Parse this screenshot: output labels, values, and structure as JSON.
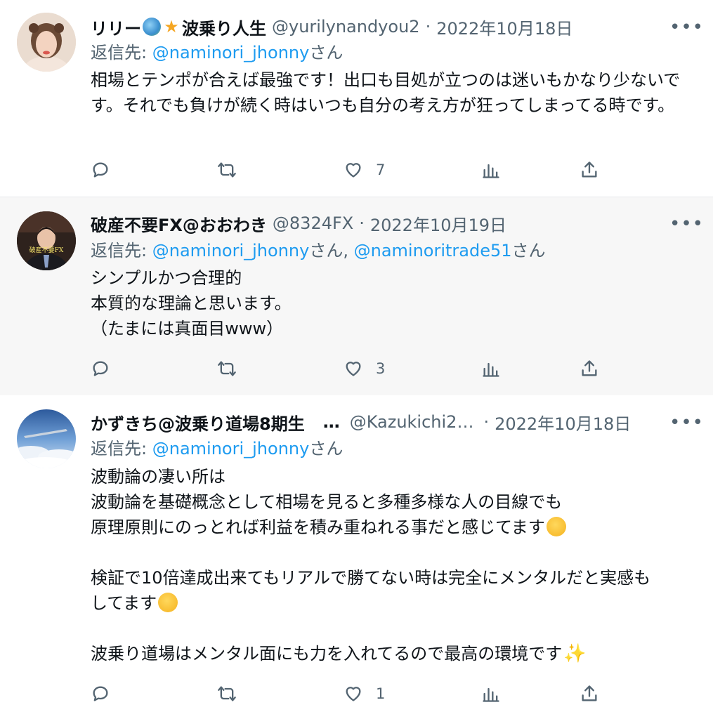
{
  "tweets": [
    {
      "display_name": "リリー",
      "name_suffix": "波乗り人生",
      "handle": "@yurilynandyou2",
      "separator": "·",
      "date": "2022年10月18日",
      "reply_prefix": "返信先:",
      "reply_to": "@naminori_jhonny",
      "reply_suffix": "さん",
      "body": "相場とテンポが合えば最強です！出口も目処が立つのは迷いもかなり少ないです。それでも負けが続く時はいつも自分の考え方が狂ってしまってる時です。",
      "like_count": "7"
    },
    {
      "display_name": "破産不要FX@おおわき",
      "handle": "@8324FX",
      "separator": "·",
      "date": "2022年10月19日",
      "reply_prefix": "返信先:",
      "reply_to": "@naminori_jhonny",
      "reply_suffix": "さん,",
      "reply_to_2": "@naminoritrade51",
      "reply_suffix_2": "さん",
      "avatar_text": "破産不要FX",
      "body_lines": [
        "シンプルかつ合理的",
        "本質的な理論と思います。",
        "（たまには真面目www）"
      ],
      "like_count": "3"
    },
    {
      "display_name": "かずきち@波乗り道場8期生",
      "ellipsis": "…",
      "handle": "@Kazukichi2…",
      "separator": "·",
      "date": "2022年10月18日",
      "reply_prefix": "返信先:",
      "reply_to": "@naminori_jhonny",
      "reply_suffix": "さん",
      "body_lines": [
        "波動論の凄い所は",
        "波動論を基礎概念として相場を見ると多種多様な人の目線でも",
        "原理原則にのっとれば利益を積み重ねれる事だと感じてます",
        "",
        "検証で10倍達成出来てもリアルで勝てない時は完全にメンタルだと実感も",
        "してます",
        "",
        "波乗り道場はメンタル面にも力を入れてるので最高の環境です"
      ],
      "like_count": "1"
    }
  ],
  "icons": {
    "reply": "reply-icon",
    "retweet": "retweet-icon",
    "like": "heart-icon",
    "views": "analytics-icon",
    "share": "share-icon",
    "more": "more-icon"
  },
  "more_glyph": "•••",
  "colors": {
    "link": "#1d9bf0",
    "muted": "#536471",
    "text": "#0f1419"
  }
}
